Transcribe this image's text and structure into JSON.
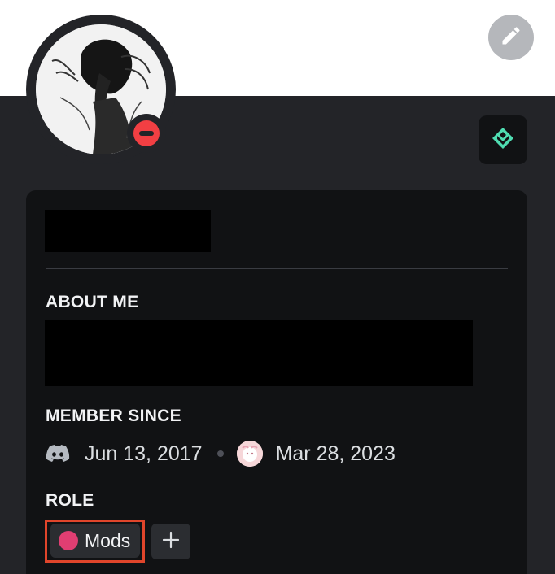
{
  "profile": {
    "status": "do-not-disturb",
    "icons": {
      "edit": "pencil-icon",
      "badge": "nitro-boost-icon",
      "status": "dnd-status-icon",
      "discord": "discord-logo-icon",
      "server": "server-icon",
      "add_role": "plus-icon"
    },
    "colors": {
      "background": "#232428",
      "card": "#111214",
      "status_dnd": "#f23f43",
      "badge_accent": "#4fdcb1",
      "role_color": "#e03e72",
      "highlight_border": "#e0452b"
    }
  },
  "about": {
    "title": "ABOUT ME"
  },
  "member_since": {
    "title": "MEMBER SINCE",
    "discord_date": "Jun 13, 2017",
    "server_date": "Mar 28, 2023"
  },
  "roles": {
    "title": "ROLE",
    "items": [
      {
        "label": "Mods",
        "color": "#e03e72"
      }
    ]
  }
}
